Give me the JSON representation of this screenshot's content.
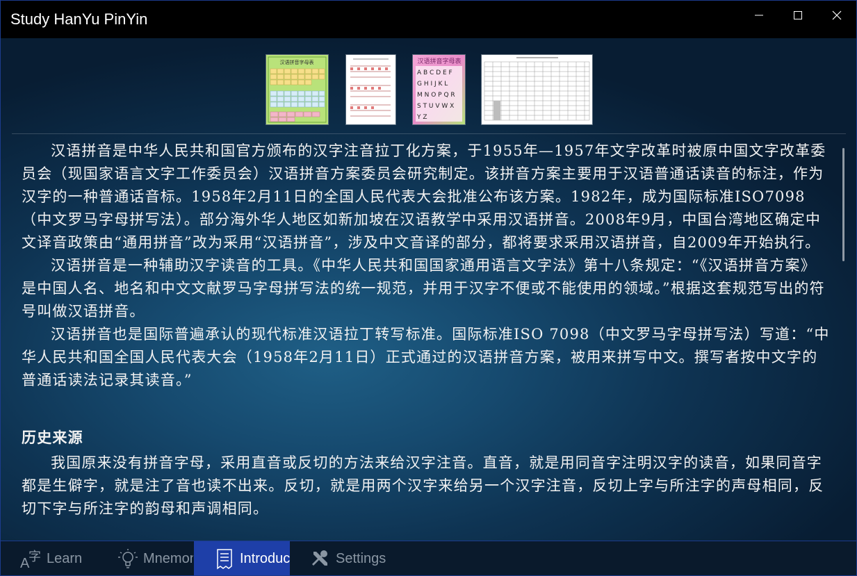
{
  "window": {
    "title": "Study HanYu PinYin",
    "controls": [
      "minimize-icon",
      "maximize-icon",
      "close-icon"
    ]
  },
  "thumbnails": [
    {
      "title": "汉语拼音字母表"
    },
    {
      "title": ""
    },
    {
      "title": "汉语拼音字母表"
    },
    {
      "title": ""
    }
  ],
  "intro": {
    "paragraphs": [
      "汉语拼音是中华人民共和国官方颁布的汉字注音拉丁化方案，于1955年—1957年文字改革时被原中国文字改革委员会（现国家语言文字工作委员会）汉语拼音方案委员会研究制定。该拼音方案主要用于汉语普通话读音的标注，作为汉字的一种普通话音标。1958年2月11日的全国人民代表大会批准公布该方案。1982年，成为国际标准ISO7098（中文罗马字母拼写法）。部分海外华人地区如新加坡在汉语教学中采用汉语拼音。2008年9月，中国台湾地区确定中文译音政策由“通用拼音”改为采用“汉语拼音”，涉及中文音译的部分，都将要求采用汉语拼音，自2009年开始执行。",
      "汉语拼音是一种辅助汉字读音的工具。《中华人民共和国国家通用语言文字法》第十八条规定：“《汉语拼音方案》是中国人名、地名和中文文献罗马字母拼写法的统一规范，并用于汉字不便或不能使用的领域。”根据这套规范写出的符号叫做汉语拼音。",
      "汉语拼音也是国际普遍承认的现代标准汉语拉丁转写标准。国际标准ISO 7098（中文罗马字母拼写法）写道：“中华人民共和国全国人民代表大会（1958年2月11日）正式通过的汉语拼音方案，被用来拼写中文。撰写者按中文字的普通话读法记录其读音。”"
    ],
    "section_heading": "历史来源",
    "section_paragraphs": [
      "我国原来没有拼音字母，采用直音或反切的方法来给汉字注音。直音，就是用同音字注明汉字的读音，如果同音字都是生僻字，就是注了音也读不出来。反切，就是用两个汉字来给另一个汉字注音，反切上字与所注字的声母相同，反切下字与所注字的韵母和声调相同。"
    ]
  },
  "nav": {
    "items": [
      {
        "label": "Learn",
        "icon": "font-a-zi-icon",
        "active": false
      },
      {
        "label": "Mnemonic",
        "icon": "lightbulb-icon",
        "active": false
      },
      {
        "label": "Introduction",
        "icon": "document-icon",
        "active": true
      },
      {
        "label": "Settings",
        "icon": "tools-icon",
        "active": false
      }
    ]
  },
  "colors": {
    "accent": "#1e3fa8",
    "titlebar": "#000000",
    "text": "#f2f2f2",
    "nav_inactive": "#8a96a3"
  }
}
